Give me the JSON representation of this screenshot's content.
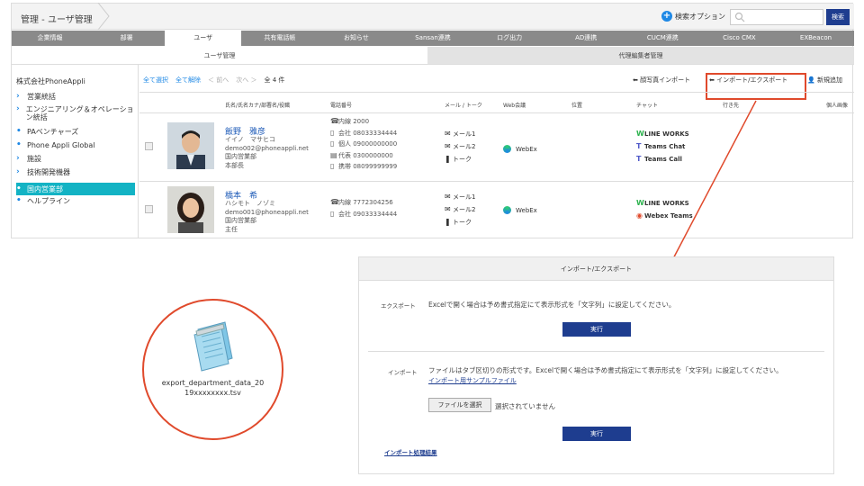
{
  "header": {
    "breadcrumb": "管理 - ユーザ管理",
    "search_option": "検索オプション",
    "search_placeholder": "",
    "search_button": "検索"
  },
  "tabs": [
    "企業情報",
    "部署",
    "ユーザ",
    "共有電話帳",
    "お知らせ",
    "Sansan連携",
    "ログ出力",
    "AD連携",
    "CUCM連携",
    "Cisco CMX",
    "EXBeacon"
  ],
  "active_tab": "ユーザ",
  "subtabs": {
    "active": "ユーザ管理",
    "other": "代理編集者管理"
  },
  "tree": {
    "root": "株式会社PhoneAppli",
    "items": [
      {
        "label": "営業統括",
        "marker": "›"
      },
      {
        "label": "エンジニアリング＆オペレーション統括",
        "marker": "›"
      },
      {
        "label": "PAベンチャーズ",
        "marker": "•"
      },
      {
        "label": "Phone Appli Global",
        "marker": "•"
      },
      {
        "label": "施設",
        "marker": "›"
      },
      {
        "label": "技術開発機器",
        "marker": "›"
      },
      {
        "label": "国内営業部",
        "marker": "•"
      },
      {
        "label": "ヘルプライン",
        "marker": "•"
      }
    ],
    "selected": "国内営業部"
  },
  "toolbar": {
    "select_all": "全て選択",
    "deselect_all": "全て解除",
    "prev": "＜ 前へ",
    "next": "次へ ＞",
    "count": "全 4 件"
  },
  "actions": {
    "photo_import": "顔写真インポート",
    "import_export": "インポート/エクスポート",
    "add_new": "新規追加"
  },
  "columns": [
    "氏名/氏名カナ/部署名/役職",
    "電話番号",
    "メール / トーク",
    "Web会議",
    "位置",
    "チャット",
    "行き先",
    "個人画像"
  ],
  "users": [
    {
      "name": "飯野　雅彦",
      "kana": "イイノ　マサヒコ",
      "email": "demo002@phoneappli.net",
      "dept": "国内営業部",
      "title": "本部長",
      "phones": [
        "内線 2000",
        "会社 08033334444",
        "個人 09000000000",
        "代表 0300000000",
        "携帯 08099999999"
      ],
      "mails": [
        "メール1",
        "メール2",
        "トーク"
      ],
      "web": "WebEx",
      "chats": [
        "LINE WORKS",
        "Teams Chat",
        "Teams Call"
      ]
    },
    {
      "name": "橋本　希",
      "kana": "ハシモト　ノゾミ",
      "email": "demo001@phoneappli.net",
      "dept": "国内営業部",
      "title": "主任",
      "phones": [
        "内線 7772304256",
        "会社 09033334444"
      ],
      "mails": [
        "メール1",
        "メール2",
        "トーク"
      ],
      "web": "WebEx",
      "chats": [
        "LINE WORKS",
        "Webex Teams"
      ]
    }
  ],
  "dialog": {
    "title": "インポート/エクスポート",
    "export_label": "エクスポート",
    "export_text": "Excelで開く場合は予め書式指定にて表示形式を「文字列」に設定してください。",
    "execute": "実行",
    "import_label": "インポート",
    "import_text": "ファイルはタブ区切りの形式です。Excelで開く場合は予め書式指定にて表示形式を「文字列」に設定してください。",
    "sample_link": "インポート用サンプルファイル",
    "choose_file": "ファイルを選択",
    "no_file": "選択されていません",
    "result_link": "インポート処理結果"
  },
  "file": {
    "name_line1": "export_department_data_20",
    "name_line2": "19xxxxxxxx.tsv"
  },
  "colors": {
    "accent": "#1e3d8f",
    "selected": "#13b3c4",
    "annotation": "#e04a2c"
  }
}
